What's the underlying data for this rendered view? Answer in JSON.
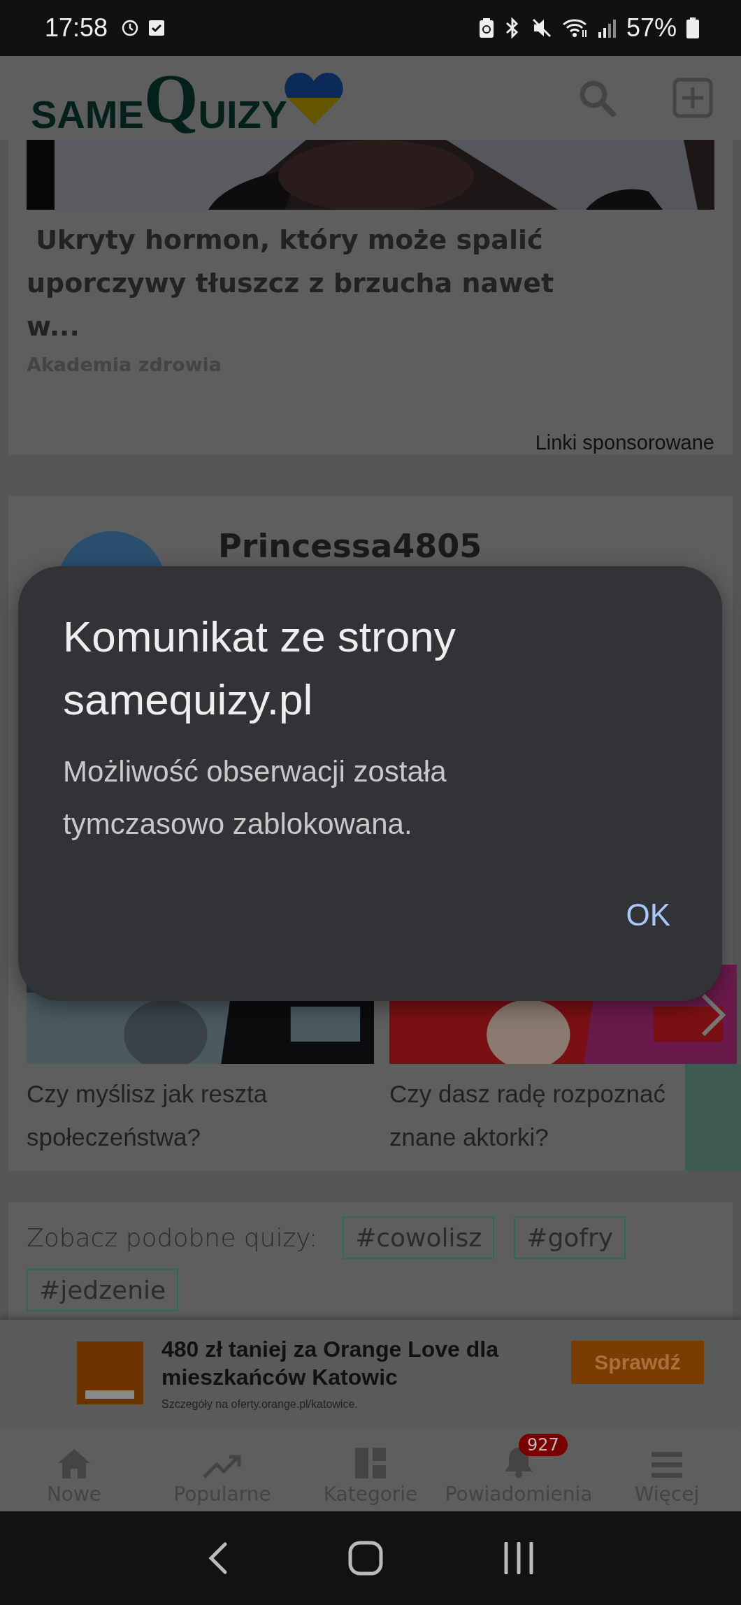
{
  "status_bar": {
    "time": "17:58",
    "battery": "57%"
  },
  "header": {
    "logo": {
      "part_1": "SAME",
      "part_2": "Q",
      "part_3": "UIZY"
    }
  },
  "sponsored": {
    "title": " Ukryty hormon, który może spalić uporczywy tłuszcz z brzucha nawet w...",
    "source": "Akademia zdrowia",
    "label": "Linki sponsorowane"
  },
  "profile": {
    "username": "Princessa4805"
  },
  "quizzes": [
    {
      "title": "Czy myślisz jak reszta społeczeństwa?"
    },
    {
      "title": "Czy dasz radę rozpoznać znane aktorki?"
    }
  ],
  "tags": {
    "label": "Zobacz podobne quizy:",
    "items": [
      "#cowolisz",
      "#gofry",
      "#jedzenie"
    ]
  },
  "banner": {
    "headline": "480 zł taniej za Orange Love dla mieszkańców Katowic",
    "note": "Szczegóły na oferty.orange.pl/katowice.",
    "button": "Sprawdź"
  },
  "bottom_nav": [
    {
      "label": "Nowe",
      "kind": "home"
    },
    {
      "label": "Popularne",
      "kind": "trend"
    },
    {
      "label": "Kategorie",
      "kind": "grid"
    },
    {
      "label": "Powiadomienia",
      "kind": "bell",
      "badge": "927"
    },
    {
      "label": "Więcej",
      "kind": "menu"
    }
  ],
  "dialog": {
    "title": "Komunikat ze strony samequizy.pl",
    "message": "Możliwość obserwacji została tymczasowo zablokowana.",
    "button": "OK"
  }
}
